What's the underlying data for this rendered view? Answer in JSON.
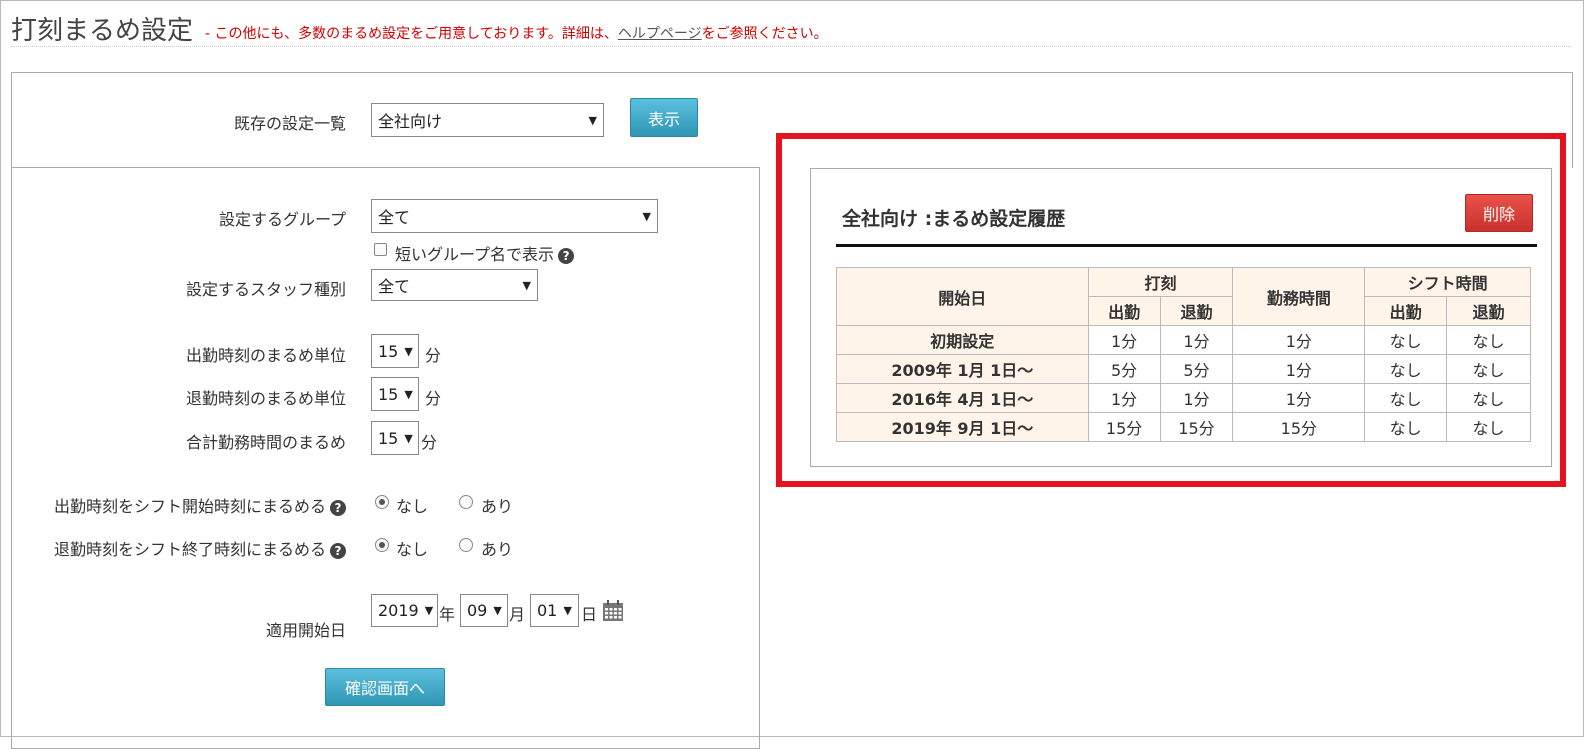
{
  "header": {
    "title": "打刻まるめ設定",
    "note_prefix": "- この他にも、多数のまるめ設定をご用意しております。詳細は、",
    "note_link": "ヘルプページ",
    "note_suffix": "をご参照ください。"
  },
  "existing": {
    "label": "既存の設定一覧",
    "selected": "全社向け",
    "show_button": "表示"
  },
  "form": {
    "group_label": "設定するグループ",
    "group_value": "全て",
    "short_name_label": "短いグループ名で表示",
    "staff_label": "設定するスタッフ種別",
    "staff_value": "全て",
    "in_round_label": "出勤時刻のまるめ単位",
    "in_round_value": "15",
    "out_round_label": "退勤時刻のまるめ単位",
    "out_round_value": "15",
    "total_round_label": "合計勤務時間のまるめ",
    "total_round_value": "15",
    "minute_unit": "分",
    "shift_start_label": "出勤時刻をシフト開始時刻にまるめる",
    "shift_end_label": "退勤時刻をシフト終了時刻にまるめる",
    "opt_none": "なし",
    "opt_yes": "あり",
    "start_date_label": "適用開始日",
    "year_value": "2019",
    "year_unit": "年",
    "month_value": "09",
    "month_unit": "月",
    "day_value": "01",
    "day_unit": "日",
    "confirm_button": "確認画面へ"
  },
  "history": {
    "title": "全社向け :まるめ設定履歴",
    "delete_button": "削除",
    "headers": {
      "start_date": "開始日",
      "punch": "打刻",
      "work_time": "勤務時間",
      "shift_time": "シフト時間",
      "in": "出勤",
      "out": "退勤"
    },
    "rows": [
      {
        "date": "初期設定",
        "punch_in": "1分",
        "punch_out": "1分",
        "work": "1分",
        "shift_in": "なし",
        "shift_out": "なし"
      },
      {
        "date": "2009年 1月 1日〜",
        "punch_in": "5分",
        "punch_out": "5分",
        "work": "1分",
        "shift_in": "なし",
        "shift_out": "なし"
      },
      {
        "date": "2016年 4月 1日〜",
        "punch_in": "1分",
        "punch_out": "1分",
        "work": "1分",
        "shift_in": "なし",
        "shift_out": "なし"
      },
      {
        "date": "2019年 9月 1日〜",
        "punch_in": "15分",
        "punch_out": "15分",
        "work": "15分",
        "shift_in": "なし",
        "shift_out": "なし"
      }
    ]
  },
  "colors": {
    "highlight_border": "#e3141f",
    "note_red": "#d40000",
    "header_bg": "#fef4ea",
    "button_blue": "#2f96b4",
    "button_red": "#c9302c"
  }
}
